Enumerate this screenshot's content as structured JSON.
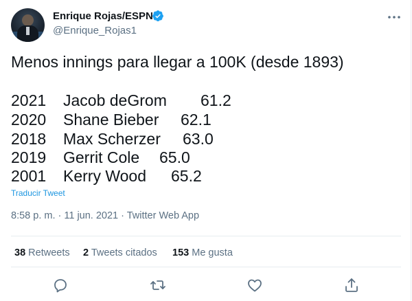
{
  "author": {
    "name": "Enrique Rojas/ESPN",
    "handle": "@Enrique_Rojas1"
  },
  "tweet": {
    "headline": "Menos innings para llegar a 100K (desde 1893)",
    "rows": [
      {
        "year": "2021",
        "name": "Jacob deGrom",
        "value": "61.2"
      },
      {
        "year": "2020",
        "name": "Shane Bieber",
        "value": "62.1"
      },
      {
        "year": "2018",
        "name": "Max Scherzer",
        "value": "63.0"
      },
      {
        "year": "2019",
        "name": "Gerrit Cole",
        "value": "65.0"
      },
      {
        "year": "2001",
        "name": "Kerry Wood",
        "value": "65.2"
      }
    ],
    "translate_label": "Traducir Tweet",
    "timestamp": "8:58 p. m. · 11 jun. 2021 · Twitter Web App"
  },
  "stats": {
    "retweets_count": "38",
    "retweets_label": "Retweets",
    "quotes_count": "2",
    "quotes_label": "Tweets citados",
    "likes_count": "153",
    "likes_label": "Me gusta"
  },
  "icons": {
    "verified": "verified-badge-icon",
    "more": "more-options-icon",
    "reply": "reply-icon",
    "retweet": "retweet-icon",
    "like": "heart-icon",
    "share": "share-icon"
  },
  "colors": {
    "accent": "#1da1f2",
    "link": "#1b95e0",
    "muted": "#5b7083",
    "text": "#0f1419"
  }
}
